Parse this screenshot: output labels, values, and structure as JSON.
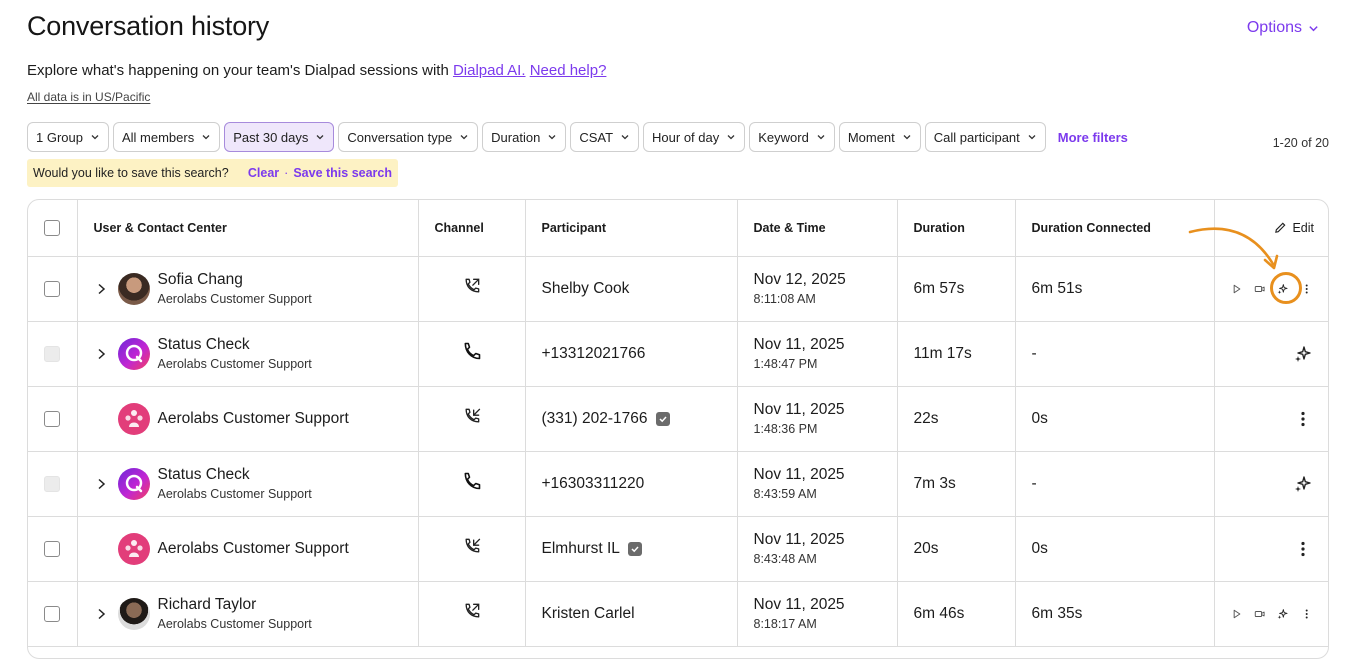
{
  "header": {
    "title": "Conversation history",
    "options_label": "Options",
    "intro_text": "Explore what's happening on your team's Dialpad sessions with ",
    "intro_link": "Dialpad AI.",
    "help_link": "Need help?",
    "timezone_note": "All data is in US/Pacific"
  },
  "filters": {
    "chips": [
      {
        "label": "1 Group",
        "active": false
      },
      {
        "label": "All members",
        "active": false
      },
      {
        "label": "Past 30 days",
        "active": true
      },
      {
        "label": "Conversation type",
        "active": false
      },
      {
        "label": "Duration",
        "active": false
      },
      {
        "label": "CSAT",
        "active": false
      },
      {
        "label": "Hour of day",
        "active": false
      },
      {
        "label": "Keyword",
        "active": false
      },
      {
        "label": "Moment",
        "active": false
      },
      {
        "label": "Call participant",
        "active": false
      }
    ],
    "more_filters": "More filters",
    "result_count": "1-20 of 20"
  },
  "save_banner": {
    "prompt": "Would you like to save this search?",
    "clear": "Clear",
    "separator": "·",
    "save": "Save this search"
  },
  "table": {
    "columns": [
      "User & Contact Center",
      "Channel",
      "Participant",
      "Date & Time",
      "Duration",
      "Duration Connected"
    ],
    "edit_label": "Edit",
    "rows": [
      {
        "name": "Sofia Chang",
        "center": "Aerolabs Customer Support",
        "avatar": "photo1",
        "expandable": true,
        "checkbox_disabled": false,
        "channel": "outbound-call-icon",
        "participant": "Shelby Cook",
        "verified": false,
        "date": "Nov 12, 2025",
        "time": "8:11:08 AM",
        "duration": "6m 57s",
        "connected": "6m 51s",
        "actions": [
          "play",
          "video",
          "ai",
          "more"
        ]
      },
      {
        "name": "Status Check",
        "center": "Aerolabs Customer Support",
        "avatar": "status",
        "expandable": true,
        "checkbox_disabled": true,
        "channel": "phone-icon",
        "participant": "+13312021766",
        "verified": false,
        "date": "Nov 11, 2025",
        "time": "1:48:47 PM",
        "duration": "11m 17s",
        "connected": "-",
        "actions": [
          "ai"
        ]
      },
      {
        "name": "Aerolabs Customer Support",
        "center": "",
        "avatar": "cc",
        "expandable": false,
        "checkbox_disabled": false,
        "channel": "inbound-call-icon",
        "participant": "(331) 202-1766",
        "verified": true,
        "date": "Nov 11, 2025",
        "time": "1:48:36 PM",
        "duration": "22s",
        "connected": "0s",
        "actions": [
          "more"
        ]
      },
      {
        "name": "Status Check",
        "center": "Aerolabs Customer Support",
        "avatar": "status",
        "expandable": true,
        "checkbox_disabled": true,
        "channel": "phone-icon",
        "participant": "+16303311220",
        "verified": false,
        "date": "Nov 11, 2025",
        "time": "8:43:59 AM",
        "duration": "7m 3s",
        "connected": "-",
        "actions": [
          "ai"
        ]
      },
      {
        "name": "Aerolabs Customer Support",
        "center": "",
        "avatar": "cc",
        "expandable": false,
        "checkbox_disabled": false,
        "channel": "inbound-call-icon",
        "participant": "Elmhurst IL",
        "verified": true,
        "date": "Nov 11, 2025",
        "time": "8:43:48 AM",
        "duration": "20s",
        "connected": "0s",
        "actions": [
          "more"
        ]
      },
      {
        "name": "Richard Taylor",
        "center": "Aerolabs Customer Support",
        "avatar": "photo2",
        "expandable": true,
        "checkbox_disabled": false,
        "channel": "outbound-call-icon",
        "participant": "Kristen Carlel",
        "verified": false,
        "date": "Nov 11, 2025",
        "time": "8:18:17 AM",
        "duration": "6m 46s",
        "connected": "6m 35s",
        "actions": [
          "play",
          "video",
          "ai",
          "more"
        ]
      }
    ]
  },
  "colors": {
    "accent": "#7c3aed",
    "highlight": "#e8901e",
    "banner": "#fdf2c4"
  }
}
